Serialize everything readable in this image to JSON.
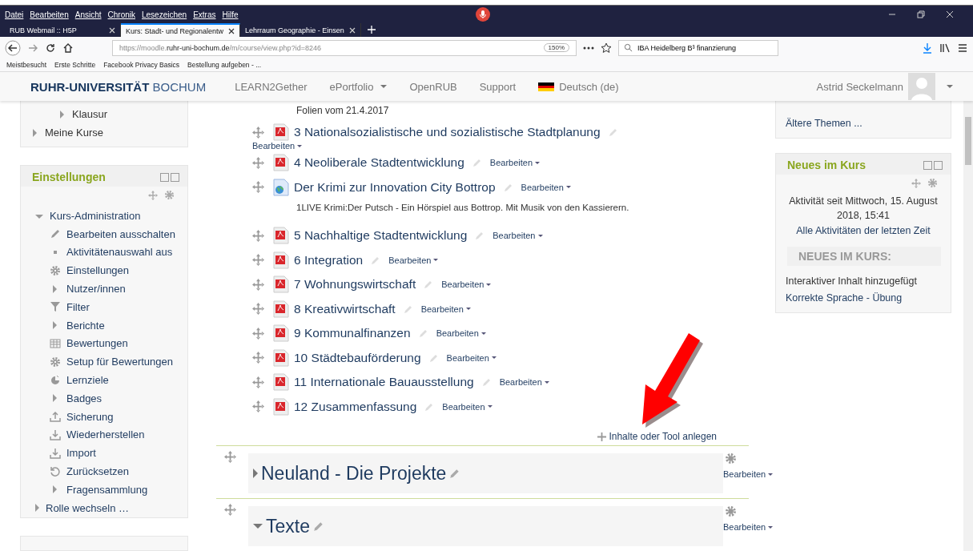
{
  "browser": {
    "menu": [
      "Datei",
      "Bearbeiten",
      "Ansicht",
      "Chronik",
      "Lesezeichen",
      "Extras",
      "Hilfe"
    ],
    "tabs": [
      {
        "label": "RUB Webmail :: H5P",
        "selected": false
      },
      {
        "label": "Kurs: Stadt- und Regionalentw",
        "selected": true
      },
      {
        "label": "Lehrraum Geographie - Einsen",
        "selected": false
      }
    ],
    "url": {
      "prefix": "https://moodle.",
      "host": "ruhr-uni-bochum.de",
      "path": "/m/course/view.php?id=8246"
    },
    "zoom": "150%",
    "search": {
      "value": "IBA Heidelberg B³ finanzierung"
    },
    "bookmarks": [
      "Meistbesucht",
      "Erste Schritte",
      "Facebook Privacy Basics",
      "Bestellung aufgeben - ..."
    ]
  },
  "header": {
    "logo_bold": "RUHR-UNIVERSITÄT",
    "logo_light": "BOCHUM",
    "nav": [
      {
        "label": "LEARN2Gether",
        "dropdown": false,
        "flag": false
      },
      {
        "label": "ePortfolio",
        "dropdown": true,
        "flag": false
      },
      {
        "label": "OpenRUB",
        "dropdown": false,
        "flag": false
      },
      {
        "label": "Support",
        "dropdown": false,
        "flag": false
      },
      {
        "label": "Deutsch (de)",
        "dropdown": false,
        "flag": true
      }
    ],
    "user": "Astrid Seckelmann"
  },
  "left": {
    "nav_items": [
      {
        "label": "Klausur",
        "nested": true
      },
      {
        "label": "Meine Kurse",
        "nested": false
      }
    ],
    "settings": {
      "title": "Einstellungen",
      "tree": [
        {
          "label": "Kurs-Administration",
          "expanded": true,
          "children": [
            {
              "label": "Bearbeiten ausschalten",
              "kind": "pencil"
            },
            {
              "label": "Aktivitätenauswahl aus",
              "kind": "dot"
            },
            {
              "label": "Einstellungen",
              "kind": "gear"
            },
            {
              "label": "Nutzer/innen",
              "kind": "branch"
            },
            {
              "label": "Filter",
              "kind": "filter"
            },
            {
              "label": "Berichte",
              "kind": "branch"
            },
            {
              "label": "Bewertungen",
              "kind": "table"
            },
            {
              "label": "Setup für Bewertungen",
              "kind": "gear"
            },
            {
              "label": "Lernziele",
              "kind": "pie"
            },
            {
              "label": "Badges",
              "kind": "branch"
            },
            {
              "label": "Sicherung",
              "kind": "upload"
            },
            {
              "label": "Wiederherstellen",
              "kind": "download"
            },
            {
              "label": "Import",
              "kind": "download"
            },
            {
              "label": "Zurücksetzen",
              "kind": "reset"
            },
            {
              "label": "Fragensammlung",
              "kind": "branch"
            }
          ]
        },
        {
          "label": "Rolle wechseln …",
          "expanded": false
        }
      ]
    }
  },
  "main": {
    "intro": "Folien vom 21.4.2017",
    "activities": [
      {
        "kind": "pdf",
        "title": "3 Nationalsozialistische und sozialistische Stadtplanung",
        "edit": "Bearbeiten"
      },
      {
        "kind": "pdf",
        "title": "4 Neoliberale Stadtentwicklung",
        "edit": "Bearbeiten"
      },
      {
        "kind": "url",
        "title": "Der Krimi zur Innovation City Bottrop",
        "edit": "Bearbeiten",
        "description": "1LIVE Krimi:Der Putsch - Ein Hörspiel aus Bottrop. Mit Musik von den Kassierern."
      },
      {
        "kind": "pdf",
        "title": "5 Nachhaltige Stadtentwicklung",
        "edit": "Bearbeiten"
      },
      {
        "kind": "pdf",
        "title": "6 Integration",
        "edit": "Bearbeiten"
      },
      {
        "kind": "pdf",
        "title": "7 Wohnungswirtschaft",
        "edit": "Bearbeiten"
      },
      {
        "kind": "pdf",
        "title": "8 Kreativwirtschaft",
        "edit": "Bearbeiten"
      },
      {
        "kind": "pdf",
        "title": "9 Kommunalfinanzen",
        "edit": "Bearbeiten"
      },
      {
        "kind": "pdf",
        "title": "10 Städtebauförderung",
        "edit": "Bearbeiten"
      },
      {
        "kind": "pdf",
        "title": "11 Internationale Bauausstellung",
        "edit": "Bearbeiten"
      },
      {
        "kind": "pdf",
        "title": "12 Zusammenfassung",
        "edit": "Bearbeiten"
      }
    ],
    "add": "Inhalte oder Tool anlegen",
    "sections": [
      {
        "title": "Neuland - Die Projekte",
        "expanded": false,
        "edit": "Bearbeiten"
      },
      {
        "title": "Texte",
        "expanded": true,
        "edit": "Bearbeiten"
      }
    ]
  },
  "right": {
    "older": "Ältere Themen ...",
    "news": {
      "title": "Neues im Kurs",
      "since": "Aktivität seit Mittwoch, 15. August 2018, 15:41",
      "all_link": "Alle Aktivitäten der letzten Zeit",
      "heading": "NEUES IM KURS:",
      "note": "Interaktiver Inhalt hinzugefügt",
      "link": "Korrekte Sprache - Übung"
    }
  }
}
